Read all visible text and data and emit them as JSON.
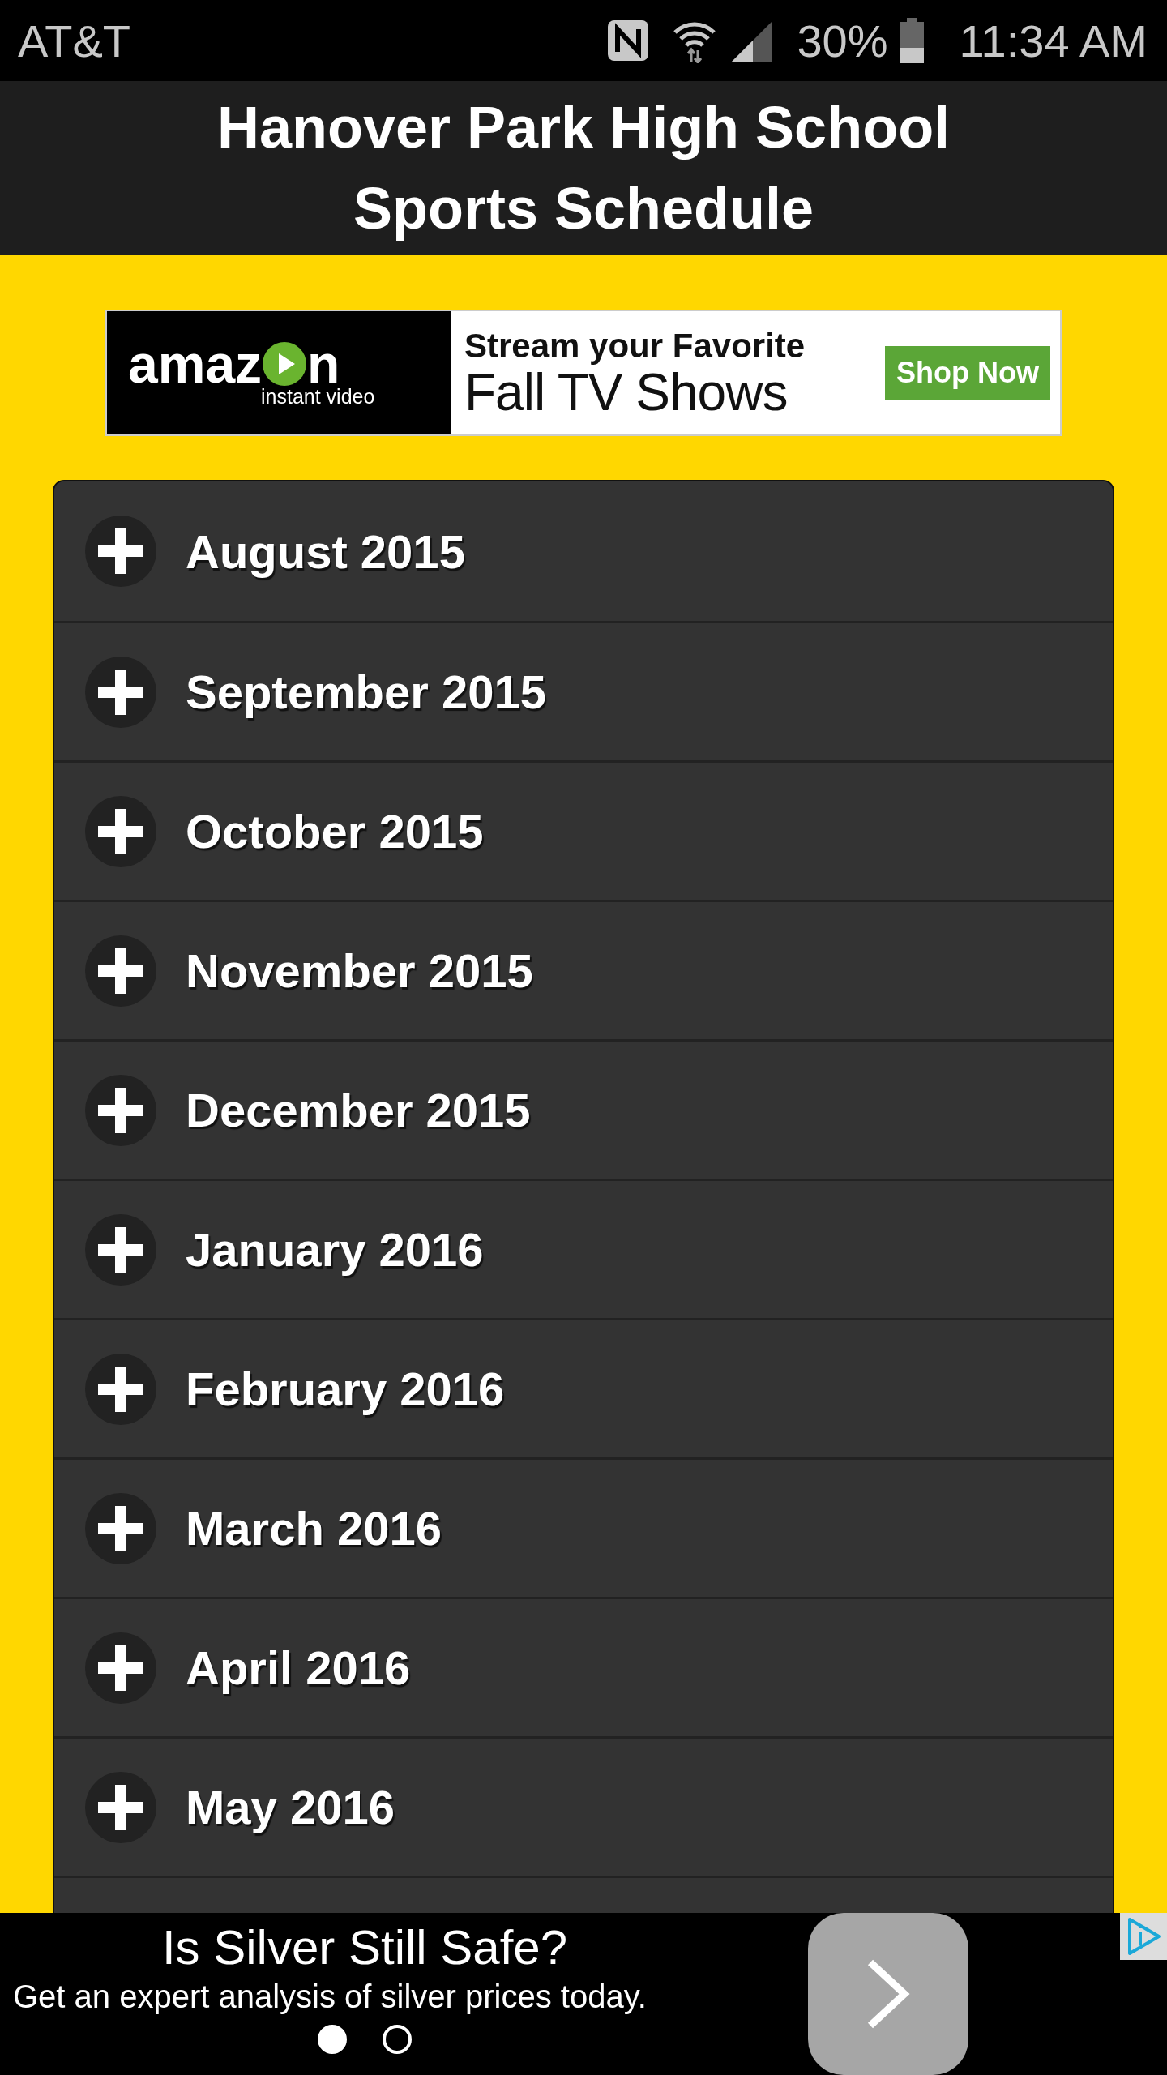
{
  "status_bar": {
    "carrier": "AT&T",
    "battery": "30%",
    "time": "11:34 AM"
  },
  "header": {
    "title_lines": [
      "Hanover Park High School",
      "Sports Schedule"
    ]
  },
  "banner_ad": {
    "logo_start": "amaz",
    "logo_end": "n",
    "logo_tagline": "instant video",
    "headline": "Stream your Favorite",
    "subline": "Fall TV Shows",
    "button": "Shop Now"
  },
  "months": [
    {
      "label": "August 2015",
      "expanded": false
    },
    {
      "label": "September 2015",
      "expanded": false
    },
    {
      "label": "October 2015",
      "expanded": false
    },
    {
      "label": "November 2015",
      "expanded": false
    },
    {
      "label": "December 2015",
      "expanded": false
    },
    {
      "label": "January 2016",
      "expanded": false
    },
    {
      "label": "February 2016",
      "expanded": false
    },
    {
      "label": "March 2016",
      "expanded": false
    },
    {
      "label": "April 2016",
      "expanded": false
    },
    {
      "label": "May 2016",
      "expanded": false
    }
  ],
  "bottom_ad": {
    "title": "Is Silver Still Safe?",
    "text": "Get an expert analysis of silver prices today.",
    "dots": [
      {
        "selected": true
      },
      {
        "selected": false
      }
    ]
  }
}
